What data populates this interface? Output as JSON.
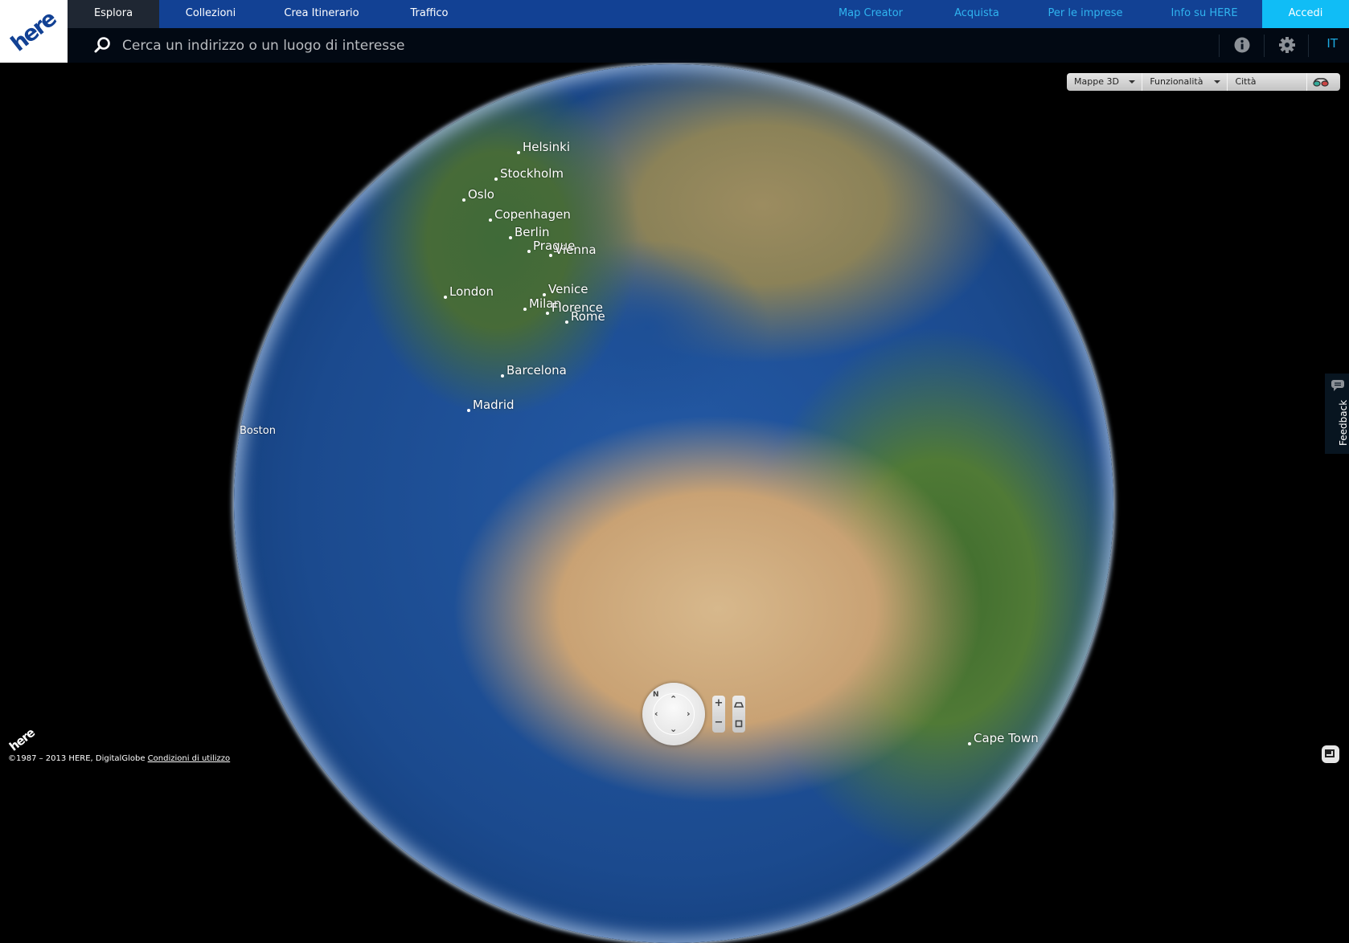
{
  "brand": {
    "logo_text": "here",
    "accent": "#124194",
    "highlight": "#10bdf6"
  },
  "nav": {
    "left": [
      {
        "label": "Esplora",
        "active": true
      },
      {
        "label": "Collezioni"
      },
      {
        "label": "Crea Itinerario"
      },
      {
        "label": "Traffico"
      }
    ],
    "right": [
      {
        "label": "Map Creator"
      },
      {
        "label": "Acquista"
      },
      {
        "label": "Per le imprese"
      },
      {
        "label": "Info su HERE"
      }
    ],
    "login_label": "Accedi"
  },
  "search": {
    "placeholder": "Cerca un indirizzo o un luogo di interesse",
    "value": "",
    "info_icon": "info-icon",
    "settings_icon": "gear-icon",
    "language": "IT"
  },
  "toolbar": {
    "map_type": "Mappe 3D",
    "features": "Funzionalità",
    "cities": "Città",
    "glasses_icon": "3d-glasses-icon"
  },
  "cities": [
    {
      "name": "Helsinki"
    },
    {
      "name": "Stockholm"
    },
    {
      "name": "Oslo"
    },
    {
      "name": "Copenhagen"
    },
    {
      "name": "Berlin"
    },
    {
      "name": "Prague"
    },
    {
      "name": "Vienna"
    },
    {
      "name": "London"
    },
    {
      "name": "Venice"
    },
    {
      "name": "Milan"
    },
    {
      "name": "Florence"
    },
    {
      "name": "Rome"
    },
    {
      "name": "Barcelona"
    },
    {
      "name": "Madrid"
    },
    {
      "name": "Boston"
    },
    {
      "name": "Cape Town"
    }
  ],
  "map_controls": {
    "compass_label": "N",
    "zoom_in": "+",
    "zoom_out": "−"
  },
  "feedback_label": "Feedback",
  "footer": {
    "logo_text": "here",
    "copyright": "©1987 – 2013 HERE, DigitalGlobe ",
    "terms_link": "Condizioni di utilizzo"
  }
}
